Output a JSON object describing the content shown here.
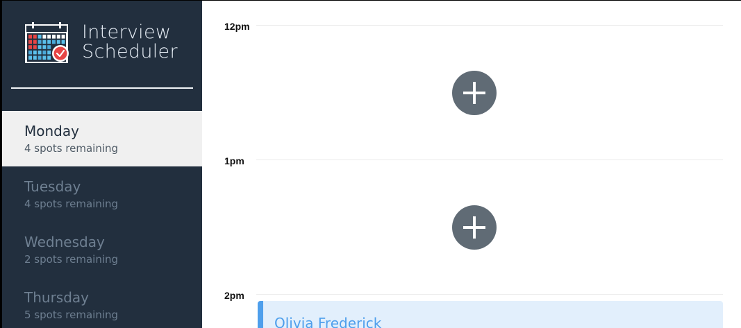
{
  "brand": {
    "title_line1": "Interview",
    "title_line2": "Scheduler",
    "logo_icon": "calendar-check-icon"
  },
  "colors": {
    "sidebar_bg": "#222f3e",
    "selected_bg": "#f0f0f0",
    "accent_blue": "#4e9fec",
    "add_button": "#606b75"
  },
  "days": [
    {
      "name": "Monday",
      "spots": "4 spots remaining",
      "selected": true
    },
    {
      "name": "Tuesday",
      "spots": "4 spots remaining",
      "selected": false
    },
    {
      "name": "Wednesday",
      "spots": "2 spots remaining",
      "selected": false
    },
    {
      "name": "Thursday",
      "spots": "5 spots remaining",
      "selected": false
    }
  ],
  "schedule": {
    "slots": [
      {
        "time": "12pm",
        "state": "empty"
      },
      {
        "time": "1pm",
        "state": "empty"
      },
      {
        "time": "2pm",
        "state": "booked",
        "student": "Olivia Frederick"
      }
    ],
    "add_icon": "plus-icon"
  }
}
